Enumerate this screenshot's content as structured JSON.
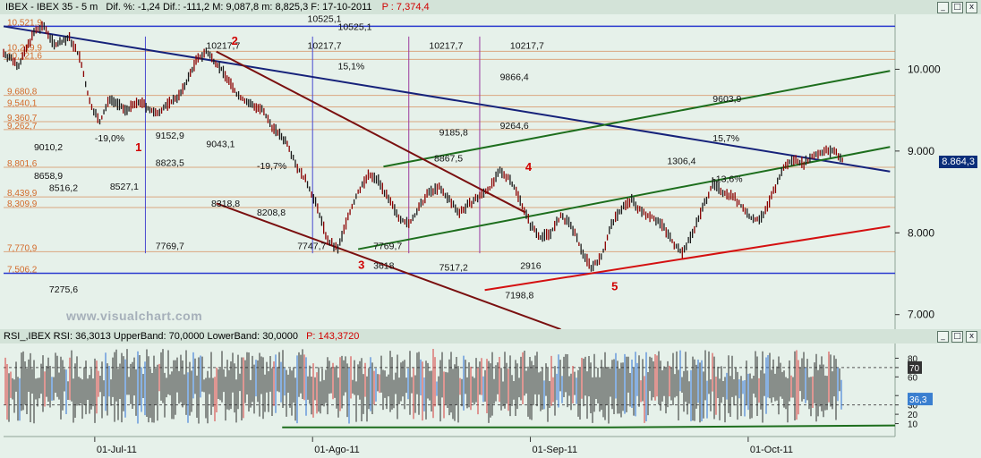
{
  "top_bar": {
    "symbol": "IBEX - IBEX 35 - 5 m",
    "stats": "Dif. %: -1,24  Dif.: -111,2  M: 9,087,8  m: 8,825,3  F: 17-10-2011",
    "p_value": "P : 7,374,4"
  },
  "rsi_bar": {
    "text": "RSI_,IBEX RSI: 36,3013  UpperBand: 70,0000  LowerBand: 30,0000",
    "p_value": "P: 143,3720"
  },
  "watermark": "www.visualchart.com",
  "window_buttons": [
    "_",
    "□",
    "x"
  ],
  "colors": {
    "background": "#e6f1ea",
    "bar_up": "#1a1a1a",
    "bar_down": "#8b0000",
    "price_box": "#0a2e7a",
    "rsi_box": "#3a7fd0"
  },
  "chart_data": [
    {
      "type": "line",
      "title": "IBEX 35 - 5 m",
      "y_ticks": [
        "10.000",
        "9.000",
        "8.000",
        "7.000"
      ],
      "x_ticks": [
        "01-Jul-11",
        "01-Ago-11",
        "01-Sep-11",
        "01-Oct-11"
      ],
      "ylim": [
        6800,
        10650
      ],
      "current_price": "8.864,3",
      "close_path": [
        [
          0,
          10200
        ],
        [
          3,
          10050
        ],
        [
          6,
          10450
        ],
        [
          8,
          10525
        ],
        [
          10,
          10300
        ],
        [
          13,
          10380
        ],
        [
          15,
          10150
        ],
        [
          17,
          9600
        ],
        [
          19,
          9350
        ],
        [
          21,
          9650
        ],
        [
          24,
          9500
        ],
        [
          27,
          9600
        ],
        [
          30,
          9450
        ],
        [
          32,
          9550
        ],
        [
          35,
          9700
        ],
        [
          38,
          10100
        ],
        [
          40,
          10217
        ],
        [
          43,
          10000
        ],
        [
          46,
          9700
        ],
        [
          48,
          9600
        ],
        [
          51,
          9500
        ],
        [
          53,
          9300
        ],
        [
          56,
          9100
        ],
        [
          58,
          8800
        ],
        [
          60,
          8600
        ],
        [
          62,
          8300
        ],
        [
          64,
          7900
        ],
        [
          66,
          7800
        ],
        [
          68,
          8200
        ],
        [
          70,
          8500
        ],
        [
          72,
          8700
        ],
        [
          74,
          8650
        ],
        [
          76,
          8400
        ],
        [
          78,
          8200
        ],
        [
          80,
          8100
        ],
        [
          82,
          8300
        ],
        [
          84,
          8500
        ],
        [
          86,
          8550
        ],
        [
          88,
          8400
        ],
        [
          90,
          8250
        ],
        [
          92,
          8350
        ],
        [
          94,
          8450
        ],
        [
          96,
          8550
        ],
        [
          98,
          8750
        ],
        [
          100,
          8660
        ],
        [
          102,
          8400
        ],
        [
          104,
          8100
        ],
        [
          106,
          7950
        ],
        [
          108,
          8000
        ],
        [
          110,
          8200
        ],
        [
          112,
          8100
        ],
        [
          114,
          7800
        ],
        [
          116,
          7580
        ],
        [
          118,
          7700
        ],
        [
          120,
          8100
        ],
        [
          122,
          8300
        ],
        [
          124,
          8400
        ],
        [
          126,
          8250
        ],
        [
          128,
          8200
        ],
        [
          130,
          8100
        ],
        [
          132,
          7900
        ],
        [
          134,
          7750
        ],
        [
          136,
          8000
        ],
        [
          138,
          8300
        ],
        [
          140,
          8600
        ],
        [
          142,
          8500
        ],
        [
          144,
          8450
        ],
        [
          146,
          8300
        ],
        [
          148,
          8150
        ],
        [
          150,
          8200
        ],
        [
          152,
          8500
        ],
        [
          154,
          8800
        ],
        [
          156,
          8900
        ],
        [
          158,
          8850
        ],
        [
          160,
          8950
        ],
        [
          162,
          9000
        ],
        [
          164,
          9000
        ],
        [
          166,
          8864
        ]
      ],
      "trend_lines": [
        {
          "name": "blue",
          "color": "#16227a",
          "from": [
            0,
            10525
          ],
          "to": [
            175,
            8750
          ]
        },
        {
          "name": "green-lower",
          "color": "#1d6e1d",
          "from": [
            70,
            7800
          ],
          "to": [
            175,
            9050
          ]
        },
        {
          "name": "green-upper",
          "color": "#1d6e1d",
          "from": [
            75,
            8810
          ],
          "to": [
            175,
            9980
          ]
        },
        {
          "name": "red",
          "color": "#d41010",
          "from": [
            95,
            7300
          ],
          "to": [
            175,
            8080
          ]
        },
        {
          "name": "maroon",
          "color": "#7a1010",
          "from": [
            42,
            10217
          ],
          "to": [
            103,
            8250
          ]
        },
        {
          "name": "maroon2",
          "color": "#7a1010",
          "from": [
            42,
            8360
          ],
          "to": [
            110,
            6820
          ]
        }
      ],
      "h_levels": [
        {
          "label": "10,521,9",
          "value": 10525,
          "color": "#d36a2a"
        },
        {
          "label": "10,219,9",
          "value": 10219,
          "color": "#d36a2a"
        },
        {
          "label": "10,121,6",
          "value": 10121,
          "color": "#d36a2a"
        },
        {
          "label": "9,680,8",
          "value": 9680,
          "color": "#d36a2a"
        },
        {
          "label": "9,540,1",
          "value": 9540,
          "color": "#d36a2a"
        },
        {
          "label": "9,360,7",
          "value": 9360,
          "color": "#d36a2a"
        },
        {
          "label": "9,262,7",
          "value": 9262,
          "color": "#d36a2a"
        },
        {
          "label": "8,801,6",
          "value": 8801,
          "color": "#d36a2a"
        },
        {
          "label": "8,439,9",
          "value": 8439,
          "color": "#d36a2a"
        },
        {
          "label": "8,309,9",
          "value": 8309,
          "color": "#d36a2a"
        },
        {
          "label": "7,770,9",
          "value": 7770,
          "color": "#d36a2a"
        },
        {
          "label": "7,506,2",
          "value": 7506,
          "color": "#d36a2a"
        }
      ],
      "annotations": [
        {
          "text": "10525,1",
          "x": 60,
          "y": 10580
        },
        {
          "text": "10217,7",
          "x": 40,
          "y": 10250
        },
        {
          "text": "10217,7",
          "x": 60,
          "y": 10250
        },
        {
          "text": "10217,7",
          "x": 84,
          "y": 10250
        },
        {
          "text": "10217,7",
          "x": 100,
          "y": 10250
        },
        {
          "text": "10525,1",
          "x": 66,
          "y": 10480
        },
        {
          "text": "15,1%",
          "x": 66,
          "y": 10000
        },
        {
          "text": "9866,4",
          "x": 98,
          "y": 9870
        },
        {
          "text": "9264,6",
          "x": 98,
          "y": 9270
        },
        {
          "text": "9185,8",
          "x": 86,
          "y": 9190
        },
        {
          "text": "9152,9",
          "x": 30,
          "y": 9150
        },
        {
          "text": "9043,1",
          "x": 40,
          "y": 9050
        },
        {
          "text": "9010,2",
          "x": 6,
          "y": 9010
        },
        {
          "text": "8823,5",
          "x": 30,
          "y": 8820
        },
        {
          "text": "8867,5",
          "x": 85,
          "y": 8870
        },
        {
          "text": "8658,9",
          "x": 6,
          "y": 8660
        },
        {
          "text": "8516,2",
          "x": 9,
          "y": 8510
        },
        {
          "text": "8527,1",
          "x": 21,
          "y": 8527
        },
        {
          "text": "8318,8",
          "x": 41,
          "y": 8320
        },
        {
          "text": "8208,8",
          "x": 50,
          "y": 8210
        },
        {
          "text": "7769,7",
          "x": 30,
          "y": 7800
        },
        {
          "text": "7747,7",
          "x": 58,
          "y": 7800
        },
        {
          "text": "7769,7",
          "x": 73,
          "y": 7800
        },
        {
          "text": "7517,2",
          "x": 86,
          "y": 7540
        },
        {
          "text": "7275,6",
          "x": 9,
          "y": 7270
        },
        {
          "text": "7198,8",
          "x": 99,
          "y": 7200
        },
        {
          "text": "9603,9",
          "x": 140,
          "y": 9600
        },
        {
          "text": "1306,4",
          "x": 131,
          "y": 8840
        },
        {
          "text": "15,7%",
          "x": 140,
          "y": 9120
        },
        {
          "text": "-13,6%",
          "x": 140,
          "y": 8620
        },
        {
          "text": "-19,0%",
          "x": 18,
          "y": 9120
        },
        {
          "text": "-19,7%",
          "x": 50,
          "y": 8780
        },
        {
          "text": "3618",
          "x": 73,
          "y": 7560
        },
        {
          "text": "2916",
          "x": 102,
          "y": 7560
        }
      ],
      "wave_labels": [
        {
          "text": "1",
          "x": 26,
          "y": 9000
        },
        {
          "text": "2",
          "x": 45,
          "y": 10300
        },
        {
          "text": "3",
          "x": 70,
          "y": 7560
        },
        {
          "text": "4",
          "x": 103,
          "y": 8760
        },
        {
          "text": "5",
          "x": 120,
          "y": 7300
        }
      ],
      "grid": true
    },
    {
      "type": "line",
      "title": "RSI_,IBEX RSI",
      "y_ticks": [
        "80",
        "70",
        "60",
        "40",
        "30",
        "20",
        "10"
      ],
      "ylim": [
        0,
        90
      ],
      "upper_band": 70,
      "lower_band": 30,
      "current_value": "36,3",
      "upper_value": "70",
      "grid": false
    }
  ]
}
